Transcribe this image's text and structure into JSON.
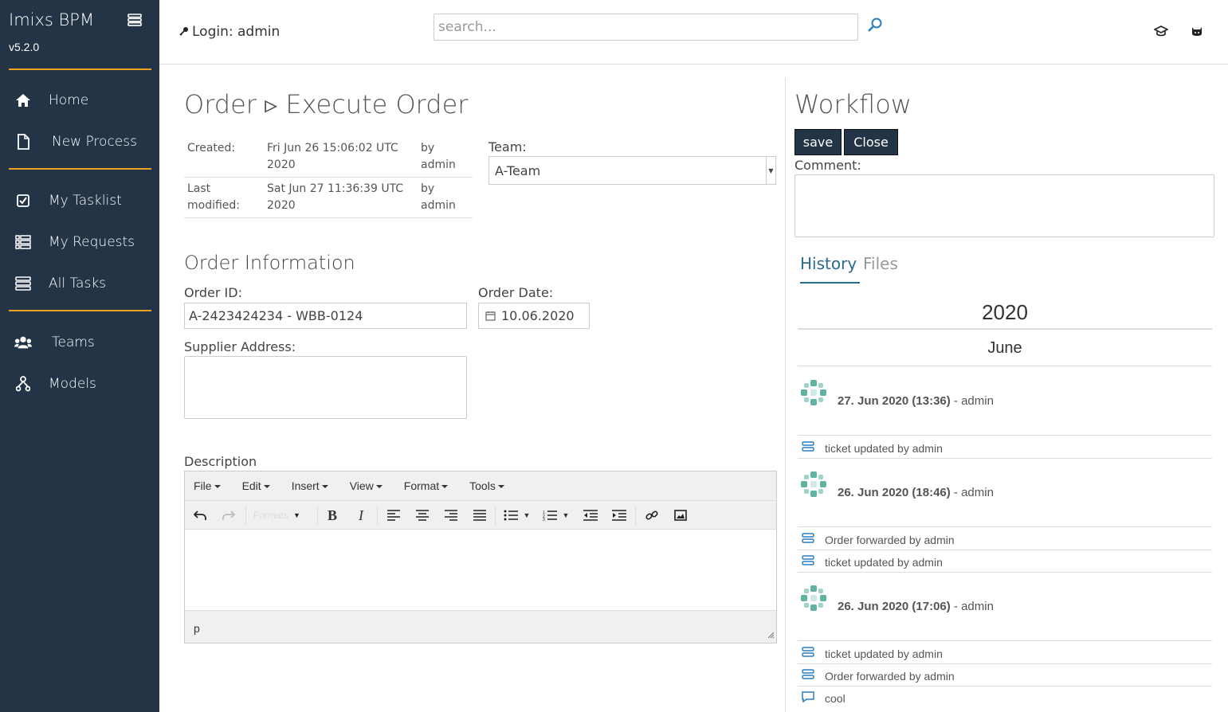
{
  "sidebar": {
    "brand": "Imixs BPM",
    "version": "v5.2.0",
    "items": [
      {
        "label": "Home",
        "icon": "home-icon"
      },
      {
        "label": "New Process",
        "icon": "file-icon"
      },
      {
        "label": "My Tasklist",
        "icon": "check-square-icon"
      },
      {
        "label": "My Requests",
        "icon": "list-icon"
      },
      {
        "label": "All Tasks",
        "icon": "stack-icon"
      },
      {
        "label": "Teams",
        "icon": "users-icon"
      },
      {
        "label": "Models",
        "icon": "sitemap-icon"
      }
    ]
  },
  "topbar": {
    "login": "Login: admin",
    "search_placeholder": "search...",
    "icons": [
      "search-icon",
      "graduation-cap-icon",
      "github-icon"
    ]
  },
  "main": {
    "title": "Order ▹ Execute Order",
    "meta": {
      "created_label": "Created:",
      "created_value": "Fri Jun 26 15:06:02 UTC 2020",
      "created_by": "by admin",
      "modified_label": "Last modified:",
      "modified_value": "Sat Jun 27 11:36:39 UTC 2020",
      "modified_by": "by admin"
    },
    "team_label": "Team:",
    "team_value": "A-Team",
    "section_title": "Order Information",
    "order_id_label": "Order ID:",
    "order_id_value": "A-2423424234 - WBB-0124",
    "order_date_label": "Order Date:",
    "order_date_value": "10.06.2020",
    "supplier_label": "Supplier Address:",
    "description_label": "Description",
    "editor": {
      "menus": [
        "File",
        "Edit",
        "Insert",
        "View",
        "Format",
        "Tools"
      ],
      "formats_label": "Formats",
      "status": "p"
    }
  },
  "workflow": {
    "title": "Workflow",
    "save_label": "save",
    "close_label": "Close",
    "comment_label": "Comment:",
    "tabs": [
      "History",
      "Files"
    ],
    "year": "2020",
    "month": "June",
    "history": [
      {
        "date": "27. Jun 2020 (13:36)",
        "user": "- admin",
        "entries": [
          {
            "icon": "stack-icon",
            "text": "ticket updated by admin"
          }
        ]
      },
      {
        "date": "26. Jun 2020 (18:46)",
        "user": "- admin",
        "entries": [
          {
            "icon": "stack-icon",
            "text": "Order forwarded by admin"
          },
          {
            "icon": "stack-icon",
            "text": "ticket updated by admin"
          }
        ]
      },
      {
        "date": "26. Jun 2020 (17:06)",
        "user": "- admin",
        "entries": [
          {
            "icon": "stack-icon",
            "text": "ticket updated by admin"
          },
          {
            "icon": "stack-icon",
            "text": "Order forwarded by admin"
          },
          {
            "icon": "comment-icon",
            "text": "cool"
          }
        ]
      }
    ]
  }
}
